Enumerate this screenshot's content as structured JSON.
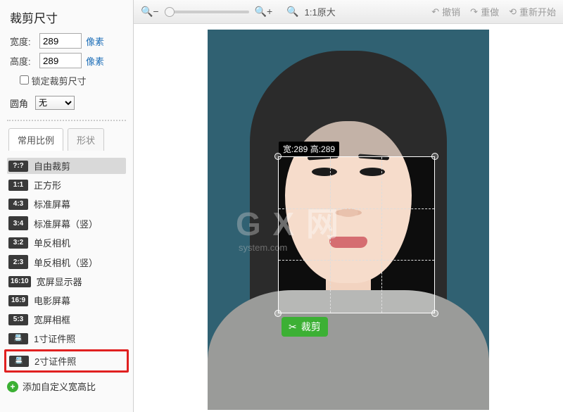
{
  "sidebar": {
    "title": "裁剪尺寸",
    "width_label": "宽度:",
    "width_value": "289",
    "height_label": "高度:",
    "height_value": "289",
    "unit": "像素",
    "lock_label": "锁定裁剪尺寸",
    "round_label": "圆角",
    "round_value": "无"
  },
  "tabs": {
    "common": "常用比例",
    "shape": "形状"
  },
  "ratios": [
    {
      "badge": "?:?",
      "label": "自由裁剪",
      "selected": true
    },
    {
      "badge": "1:1",
      "label": "正方形"
    },
    {
      "badge": "4:3",
      "label": "标准屏幕"
    },
    {
      "badge": "3:4",
      "label": "标准屏幕（竖）",
      "port": true
    },
    {
      "badge": "3:2",
      "label": "单反相机"
    },
    {
      "badge": "2:3",
      "label": "单反相机（竖）",
      "port": true
    },
    {
      "badge": "16:10",
      "label": "宽屏显示器"
    },
    {
      "badge": "16:9",
      "label": "电影屏幕"
    },
    {
      "badge": "5:3",
      "label": "宽屏相框"
    },
    {
      "badge": "📇",
      "label": "1寸证件照"
    },
    {
      "badge": "📇",
      "label": "2寸证件照",
      "highlight": true
    }
  ],
  "add_ratio": "添加自定义宽高比",
  "toolbar": {
    "zoom_label": "1:1原大",
    "undo": "撤销",
    "redo": "重做",
    "restart": "重新开始"
  },
  "crop": {
    "label": "宽:289 高:289",
    "button": "裁剪"
  },
  "watermark": {
    "big": "G X 网",
    "small": "system.com"
  }
}
